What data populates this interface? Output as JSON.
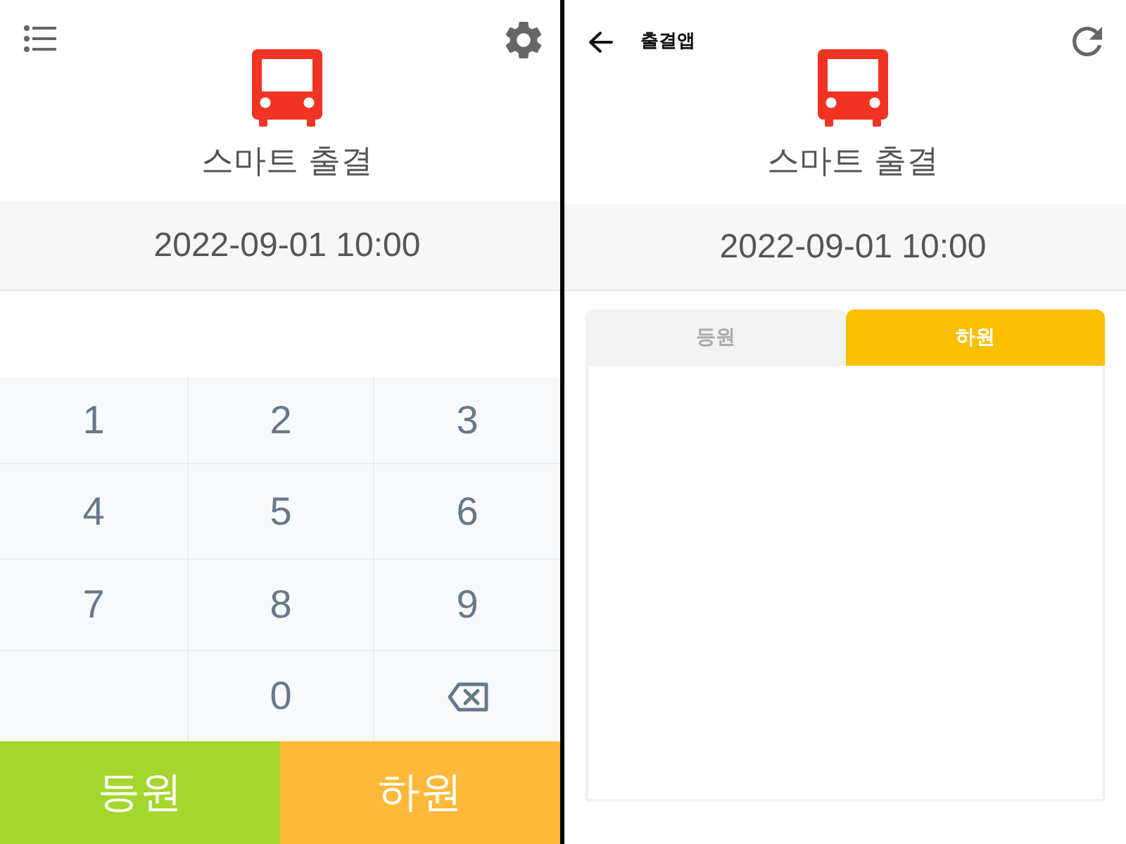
{
  "left_screen": {
    "title": "스마트 출결",
    "datetime": "2022-09-01 10:00",
    "keypad": [
      {
        "kind": "digit",
        "label": "1"
      },
      {
        "kind": "digit",
        "label": "2"
      },
      {
        "kind": "digit",
        "label": "3"
      },
      {
        "kind": "digit",
        "label": "4"
      },
      {
        "kind": "digit",
        "label": "5"
      },
      {
        "kind": "digit",
        "label": "6"
      },
      {
        "kind": "digit",
        "label": "7"
      },
      {
        "kind": "digit",
        "label": "8"
      },
      {
        "kind": "digit",
        "label": "9"
      },
      {
        "kind": "blank"
      },
      {
        "kind": "digit",
        "label": "0"
      },
      {
        "kind": "backspace"
      }
    ],
    "actions": [
      {
        "label": "등원",
        "color": "#a4d62e"
      },
      {
        "label": "하원",
        "color": "#ffb839"
      }
    ]
  },
  "right_screen": {
    "app_title": "출결앱",
    "title": "스마트 출결",
    "datetime": "2022-09-01 10:00",
    "tabs": [
      {
        "label": "등원",
        "selected": false
      },
      {
        "label": "하원",
        "selected": true
      }
    ]
  }
}
